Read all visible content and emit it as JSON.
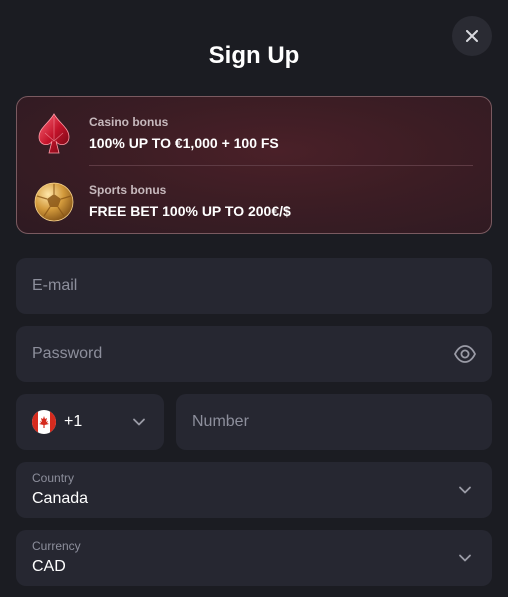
{
  "header": {
    "title": "Sign Up",
    "close_icon": "close-icon"
  },
  "bonuses": [
    {
      "icon": "spade-gem-icon",
      "kicker": "Casino bonus",
      "text": "100% UP TO €1,000 + 100 FS"
    },
    {
      "icon": "soccer-ball-icon",
      "kicker": "Sports bonus",
      "text": "FREE BET 100% UP TO 200€/$"
    }
  ],
  "form": {
    "email": {
      "placeholder": "E-mail"
    },
    "password": {
      "placeholder": "Password",
      "icon": "eye-icon"
    },
    "phone": {
      "country_icon": "canada-flag-icon",
      "code": "+1",
      "placeholder": "Number"
    },
    "country": {
      "label": "Country",
      "value": "Canada"
    },
    "currency": {
      "label": "Currency",
      "value": "CAD"
    }
  },
  "colors": {
    "background": "#1b1c22",
    "field": "#262731",
    "accent_card": "#3c1d24"
  }
}
